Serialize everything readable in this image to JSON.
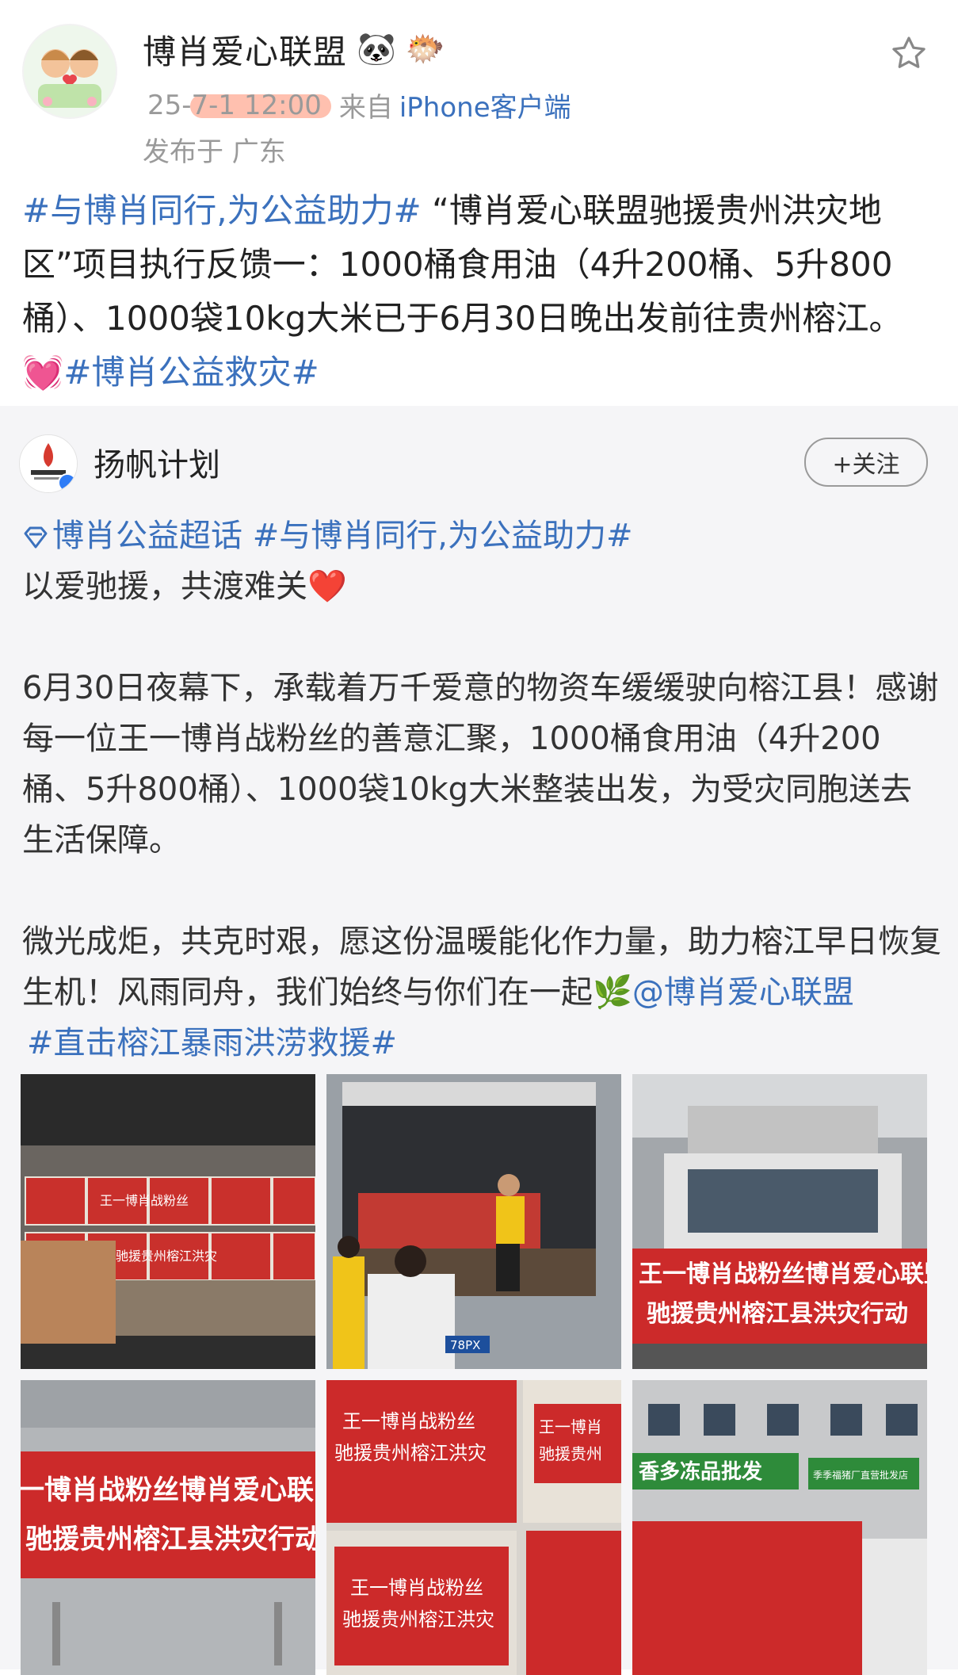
{
  "post": {
    "author": "博肖爱心联盟",
    "author_emojis": [
      "🐼",
      "🐡"
    ],
    "time": "25-7-1 12:00",
    "source_prefix": "来自",
    "source_client": "iPhone客户端",
    "location": "发布于 广东",
    "text": {
      "tag1": "#与博肖同行,为公益助力#",
      "body": " “博肖爱心联盟驰援贵州洪灾地区”项目执行反馈一：1000桶食用油（4升200桶、5升800桶）、1000袋10kg大米已于6月30日晚出发前往贵州榕江。",
      "emoji": "💓",
      "tag2": "#博肖公益救灾#"
    }
  },
  "repost": {
    "author": "扬帆计划",
    "follow_label": "+关注",
    "super_topic": "博肖公益超话",
    "tag_line": " #与博肖同行,为公益助力#",
    "line1": "以爱驰援，共渡难关",
    "heart": "❤️",
    "para1": "6月30日夜幕下，承载着万千爱意的物资车缓缓驶向榕江县！感谢每一位王一博肖战粉丝的善意汇聚，1000桶食用油（4升200桶、5升800桶）、1000袋10kg大米整装出发，为受灾同胞送去生活保障。",
    "para2": "微光成炬，共克时艰，愿这份温暖能化作力量，助力榕江早日恢复生机！风雨同舟，我们始终与你们在一起",
    "leaf": "🌿",
    "mention": "@博肖爱心联盟",
    "tag_last": "#直击榕江暴雨洪涝救援#",
    "photos": [
      {
        "box_label": "王一博肖战粉丝",
        "box_label2": "驰援贵州榕江洪灾"
      },
      {
        "plate": "78PX"
      },
      {
        "banner1": "王一博肖战粉丝博肖爱心联盟",
        "banner2": "驰援贵州榕江县洪灾行动"
      },
      {
        "banner1": "一博肖战粉丝博肖爱心联",
        "banner2": "驰援贵州榕江县洪灾行动"
      },
      {
        "bag_line1": "王一博肖战粉丝",
        "bag_line2": "驰援贵州榕江洪灾",
        "bag2_line1": "王一博肖",
        "bag2_line2": "驰援贵州"
      },
      {
        "sign": "香多冻品批发",
        "sign2": "季季福猪厂直营批发店"
      }
    ]
  },
  "colors": {
    "link": "#3b71bd",
    "banner_red": "#d42a2a",
    "bg_repost": "#f5f5f7"
  }
}
